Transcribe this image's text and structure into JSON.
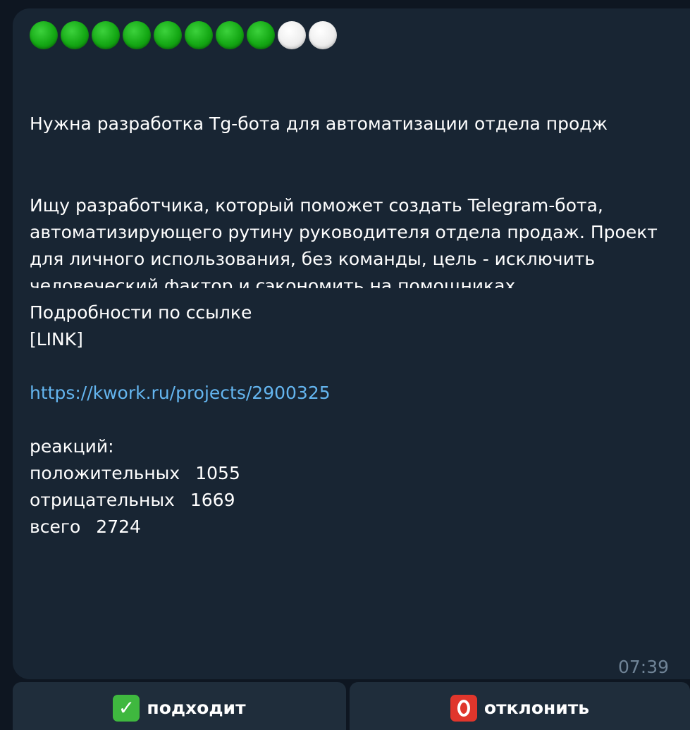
{
  "message": {
    "rating": {
      "filled": 8,
      "total": 10,
      "filled_icon": "green-circle-icon",
      "empty_icon": "white-circle-icon",
      "filled_color": "#14a814",
      "empty_color": "#eeeeee"
    },
    "title": "Нужна разработка Tg-бота для автоматизации отдела продж",
    "description": "Ищу разработчика, который поможет создать Telegram-бота, автоматизирующего рутину руководителя отдела продаж. Проект для личного использования, без команды, цель - исключить человеческий фактор и сэкономить на помощниках.",
    "more_text": "Подробности по ссылке",
    "link_token": "[LINK]",
    "url": "https://kwork.ru/projects/2900325",
    "reactions": {
      "header": "реакций:",
      "positive_label": "положительных",
      "positive_value": "1055",
      "negative_label": "отрицательных",
      "negative_value": "1669",
      "total_label": "всего",
      "total_value": "2724"
    },
    "time": "07:39"
  },
  "buttons": {
    "accept": {
      "label": "подходит",
      "icon": "check-mark-button-icon"
    },
    "reject": {
      "label": "отклонить",
      "icon": "red-o-button-icon"
    }
  },
  "colors": {
    "background": "#0e1621",
    "bubble": "#182533",
    "button": "#1f2d3b",
    "link": "#64b5ef",
    "time": "#6f8396"
  }
}
